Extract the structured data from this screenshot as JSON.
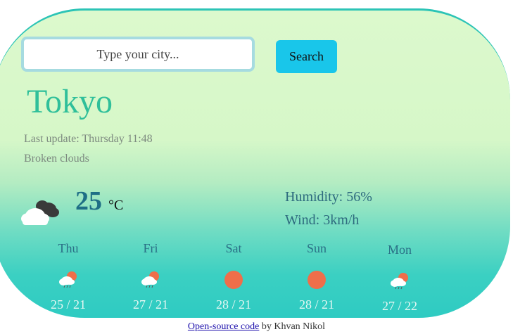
{
  "search": {
    "placeholder": "Type your city...",
    "button_label": "Search"
  },
  "weather": {
    "city": "Tokyo",
    "last_update": "Last update: Thursday 11:48",
    "description": "Broken clouds",
    "temperature": "25",
    "unit": "°C",
    "humidity": "Humidity: 56%",
    "wind": "Wind: 3km/h",
    "icon": "broken-clouds-icon"
  },
  "forecast": [
    {
      "day": "Thu",
      "temps": "25 / 21",
      "icon": "rain-sun-icon"
    },
    {
      "day": "Fri",
      "temps": "27 / 21",
      "icon": "rain-sun-icon"
    },
    {
      "day": "Sat",
      "temps": "28 / 21",
      "icon": "sun-icon"
    },
    {
      "day": "Sun",
      "temps": "28 / 21",
      "icon": "sun-icon"
    },
    {
      "day": "Mon",
      "temps": "27 / 22",
      "icon": "rain-sun-icon"
    }
  ],
  "footer": {
    "link_text": "Open-source code",
    "suffix": " by Khvan Nikol"
  },
  "colors": {
    "accent": "#19c6ea",
    "city": "#2fbf9a",
    "sun": "#ef6e4a"
  }
}
